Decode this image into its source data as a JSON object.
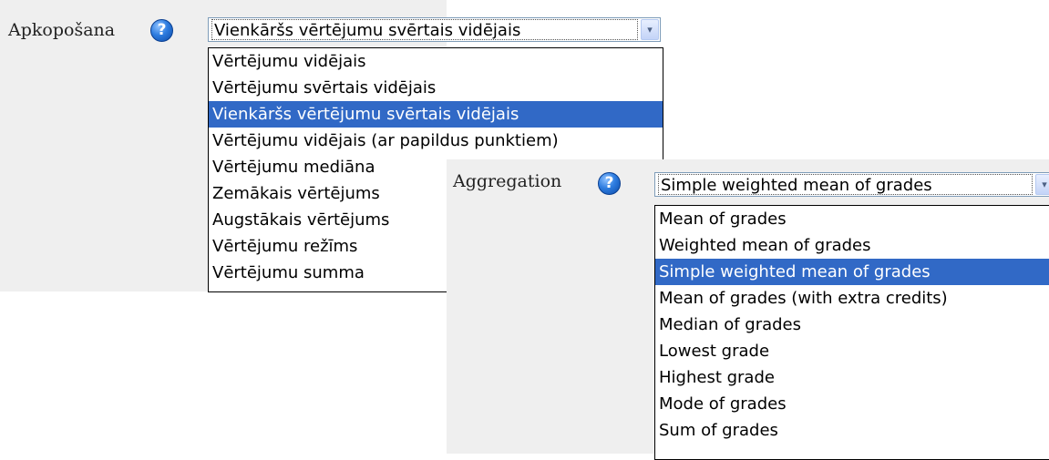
{
  "latvian": {
    "label": "Apkopošana",
    "help_icon": "question-help-icon",
    "help_glyph": "?",
    "select": {
      "value": "Vienkāršs vērtējumu svērtais vidējais",
      "arrow_icon": "chevron-down-icon",
      "arrow_glyph": "▾"
    },
    "options": [
      "Vērtējumu vidējais",
      "Vērtējumu svērtais vidējais",
      "Vienkāršs vērtējumu svērtais vidējais",
      "Vērtējumu vidējais (ar papildus punktiem)",
      "Vērtējumu mediāna",
      "Zemākais vērtējums",
      "Augstākais vērtējums",
      "Vērtējumu režīms",
      "Vērtējumu summa"
    ],
    "selected_option": "Vienkāršs vērtējumu svērtais vidējais"
  },
  "english": {
    "label": "Aggregation",
    "help_icon": "question-help-icon",
    "help_glyph": "?",
    "select": {
      "value": "Simple weighted mean of grades",
      "arrow_icon": "chevron-down-icon",
      "arrow_glyph": "▾"
    },
    "options": [
      "Mean of grades",
      "Weighted mean of grades",
      "Simple weighted mean of grades",
      "Mean of grades (with extra credits)",
      "Median of grades",
      "Lowest grade",
      "Highest grade",
      "Mode of grades",
      "Sum of grades"
    ],
    "selected_option": "Simple weighted mean of grades"
  },
  "colors": {
    "panel_background": "#efefef",
    "selection_highlight": "#3169c6",
    "help_icon_blue": "#2e7de0",
    "select_border": "#7f9db9"
  }
}
